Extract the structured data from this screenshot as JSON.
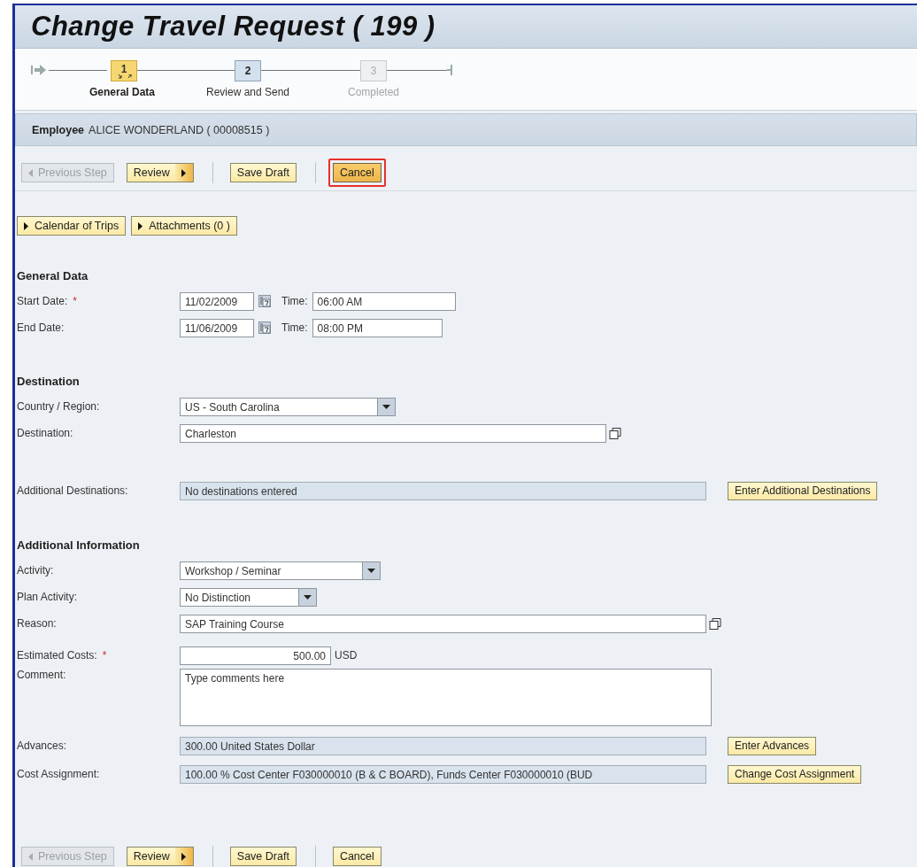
{
  "title": "Change Travel Request ( 199 )",
  "steps": [
    {
      "number": "1",
      "label": "General Data",
      "selected": true,
      "disabled": false
    },
    {
      "number": "2",
      "label": "Review and Send",
      "selected": false,
      "disabled": false
    },
    {
      "number": "3",
      "label": "Completed",
      "selected": false,
      "disabled": true
    }
  ],
  "employee": {
    "label": "Employee",
    "value": "ALICE WONDERLAND ( 00008515 )"
  },
  "toolbar_top": [
    {
      "label": "Previous Step",
      "kind": "prev",
      "disabled": true,
      "focused": false,
      "annotated": false
    },
    {
      "label": "Review",
      "kind": "next",
      "disabled": false,
      "focused": false,
      "annotated": false
    },
    {
      "label": "Save Draft",
      "kind": "plain",
      "disabled": false,
      "focused": false,
      "annotated": false
    },
    {
      "label": "Cancel",
      "kind": "plain",
      "disabled": false,
      "focused": true,
      "annotated": true
    }
  ],
  "expanders": [
    {
      "label": "Calendar of Trips"
    },
    {
      "label": "Attachments (0 )"
    }
  ],
  "sections": [
    {
      "title": "General Data",
      "rows": [
        {
          "kind": "date",
          "label": "Start Date:",
          "required_mark": "*",
          "value": "11/02/2009",
          "time_label": "Time:",
          "time": "06:00 AM"
        },
        {
          "kind": "date",
          "label": "End Date:",
          "value": "11/06/2009",
          "time_label": "Time:",
          "time": "08:00 PM"
        }
      ]
    },
    {
      "title": "Destination",
      "rows": [
        {
          "kind": "dropdown",
          "label": "Country / Region:",
          "value": "US - South Carolina"
        },
        {
          "kind": "lookup",
          "label": "Destination:",
          "value": "Charleston"
        },
        {
          "kind": "readonly",
          "label": "Additional Destinations:",
          "value": "No destinations entered",
          "button": "Enter Additional Destinations"
        }
      ]
    },
    {
      "title": "Additional Information",
      "rows": [
        {
          "kind": "dropdown",
          "label": "Activity:",
          "value": "Workshop / Seminar"
        },
        {
          "kind": "dropdown",
          "label": "Plan Activity:",
          "value": "No Distinction"
        },
        {
          "kind": "lookup",
          "label": "Reason:",
          "value": "SAP Training Course"
        },
        {
          "kind": "amount",
          "label": "Estimated Costs:",
          "required_mark": "*",
          "value": "500.00",
          "currency": "USD"
        },
        {
          "kind": "textarea",
          "label": "Comment:",
          "value": "Type comments here"
        },
        {
          "kind": "readonly",
          "label": "Advances:",
          "value": "300.00 United States Dollar",
          "button": "Enter Advances"
        },
        {
          "kind": "readonly",
          "label": "Cost Assignment:",
          "value": "100.00 % Cost Center F030000010 (B & C BOARD), Funds Center F030000010 (BUD",
          "button": "Change Cost Assignment"
        }
      ]
    }
  ],
  "toolbar_bottom": [
    {
      "label": "Previous Step",
      "kind": "prev",
      "disabled": true,
      "focused": false,
      "annotated": false
    },
    {
      "label": "Review",
      "kind": "next",
      "disabled": false,
      "focused": false,
      "annotated": false
    },
    {
      "label": "Save Draft",
      "kind": "plain",
      "disabled": false,
      "focused": false,
      "annotated": false
    },
    {
      "label": "Cancel",
      "kind": "plain",
      "disabled": false,
      "focused": false,
      "annotated": false
    }
  ]
}
